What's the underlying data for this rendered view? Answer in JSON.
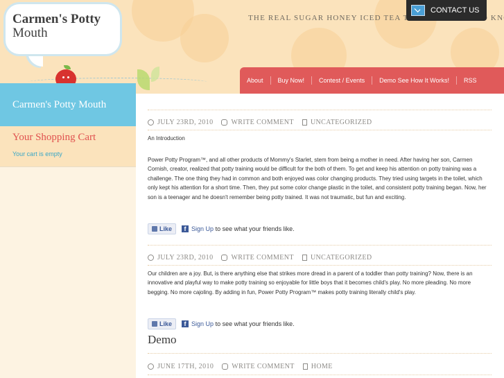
{
  "header": {
    "logo_line1": "Carmen's Potty",
    "logo_line2": "Mouth",
    "tagline": "THE REAL SUGAR HONEY ICED TEA THAT YOU NEED TO KNOW",
    "contact_label": "CONTACT US"
  },
  "nav": {
    "items": [
      "About",
      "Buy Now!",
      "Contest / Events",
      "Demo See How It Works!",
      "RSS"
    ]
  },
  "sidebar": {
    "title": "Carmen's Potty Mouth",
    "cart_heading": "Your Shopping Cart",
    "cart_empty": "Your cart is empty"
  },
  "posts": [
    {
      "date": "JULY 23RD, 2010",
      "comment": "WRITE COMMENT",
      "category": "UNCATEGORIZED",
      "intro": "An Introduction",
      "body": "Power Potty Program™, and all other products of Mommy's Starlet, stem from being a mother in need. After having her son, Carmen Cornish, creator, realized that potty training would be difficult for the both of them. To get and keep his attention on potty training was a challenge. The one thing they had in common and both enjoyed was color changing products. They tried using targets in the toilet, which only kept his attention for a short time. Then, they put some color change plastic in the toilet, and consistent potty training began. Now, her son is a teenager and he doesn't remember being potty trained. It was not traumatic, but fun and exciting."
    },
    {
      "date": "JULY 23RD, 2010",
      "comment": "WRITE COMMENT",
      "category": "UNCATEGORIZED",
      "body": "Our children are a joy. But, is there anything else that strikes more dread in a parent of a toddler than potty training? Now, there is an innovative and playful way to make potty training so enjoyable for little boys that it becomes child's play. No more pleading. No more begging. No more cajoling. By adding in fun, Power Potty Program™ makes potty training literally child's play."
    },
    {
      "title": "Demo",
      "date": "JUNE 17TH, 2010",
      "comment": "WRITE COMMENT",
      "category": "HOME"
    }
  ],
  "facebook": {
    "like": "Like",
    "sign_up": "Sign Up",
    "suffix": "to see what your friends like."
  },
  "icons": [
    "envelope-icon",
    "clock-icon",
    "comment-icon",
    "document-icon",
    "thumbs-up-icon",
    "facebook-icon"
  ],
  "colors": {
    "nav_red": "#e05a5a",
    "sidebar_blue": "#6fc7e3",
    "cart_red": "#e0524f",
    "cart_link": "#3aa7c6",
    "header_bg": "#fbe3bc"
  }
}
